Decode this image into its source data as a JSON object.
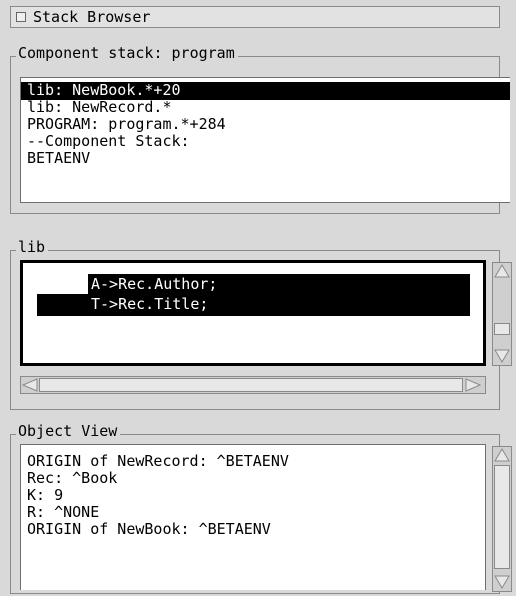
{
  "window": {
    "title": "Stack Browser"
  },
  "component_stack": {
    "label": "Component stack: program",
    "items": [
      "lib: NewBook.*+20",
      "lib: NewRecord.*",
      "PROGRAM: program.*+284",
      "--Component Stack:",
      "BETAENV"
    ],
    "selected_index": 0
  },
  "lib": {
    "label": "lib",
    "code_lines": [
      "A->Rec.Author;",
      "T->Rec.Title;"
    ]
  },
  "object_view": {
    "label": "Object View",
    "lines": [
      "ORIGIN of NewRecord: ^BETAENV",
      "Rec: ^Book",
      "K: 9",
      "R: ^NONE",
      "ORIGIN of NewBook: ^BETAENV"
    ]
  },
  "colors": {
    "background": "#d9d9d9",
    "selection": "#000000",
    "selection_text": "#ffffff",
    "list_background": "#ffffff"
  }
}
